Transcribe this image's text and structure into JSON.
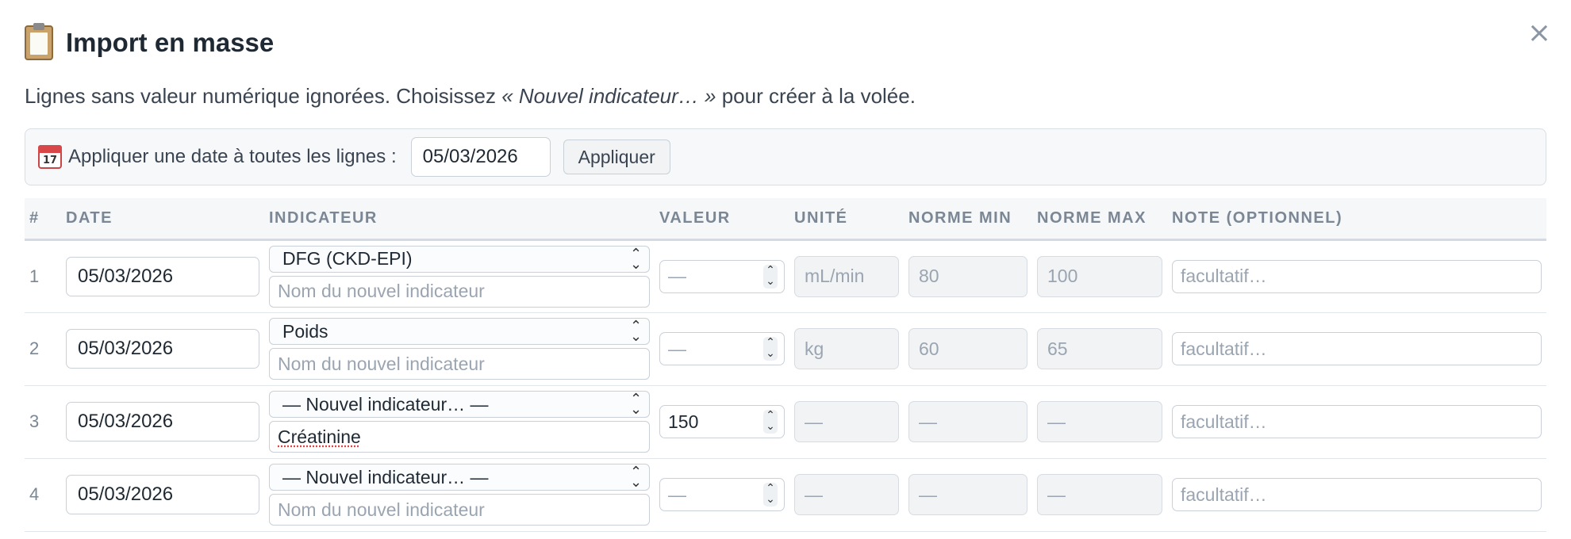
{
  "dialog": {
    "title": "Import en masse",
    "close_label": "×",
    "hint_before": "Lignes sans valeur numérique ignorées. Choisissez ",
    "hint_em": "« Nouvel indicateur… »",
    "hint_after": " pour créer à la volée.",
    "title_icon": "clipboard-icon",
    "close_icon": "close-icon"
  },
  "apply_bar": {
    "icon": "calendar-icon",
    "icon_day": "17",
    "label": "Appliquer une date à toutes les lignes :",
    "date_value": "05/03/2026",
    "button_label": "Appliquer"
  },
  "table": {
    "headers": [
      "#",
      "DATE",
      "INDICATEUR",
      "VALEUR",
      "UNITÉ",
      "NORME MIN",
      "NORME MAX",
      "NOTE (OPTIONNEL)"
    ],
    "rows": [
      {
        "num": "1",
        "date": "05/03/2026",
        "indicator": "DFG (CKD-EPI)",
        "new_name": "",
        "new_name_placeholder": "Nom du nouvel indicateur",
        "value": "—",
        "unit": "mL/min",
        "norm_min": "80",
        "norm_max": "100",
        "note_placeholder": "facultatif…"
      },
      {
        "num": "2",
        "date": "05/03/2026",
        "indicator": "Poids",
        "new_name": "",
        "new_name_placeholder": "Nom du nouvel indicateur",
        "value": "—",
        "unit": "kg",
        "norm_min": "60",
        "norm_max": "65",
        "note_placeholder": "facultatif…"
      },
      {
        "num": "3",
        "date": "05/03/2026",
        "indicator": "— Nouvel indicateur… —",
        "new_name": "Créatinine",
        "new_name_placeholder": "Nom du nouvel indicateur",
        "value": "150",
        "unit": "—",
        "norm_min": "—",
        "norm_max": "—",
        "note_placeholder": "facultatif…"
      },
      {
        "num": "4",
        "date": "05/03/2026",
        "indicator": "— Nouvel indicateur… —",
        "new_name": "",
        "new_name_placeholder": "Nom du nouvel indicateur",
        "value": "—",
        "unit": "—",
        "norm_min": "—",
        "norm_max": "—",
        "note_placeholder": "facultatif…"
      }
    ]
  },
  "colors": {
    "header_text": "#7b8794",
    "border": "#c9d0d8",
    "readonly_bg": "#f1f3f5"
  }
}
